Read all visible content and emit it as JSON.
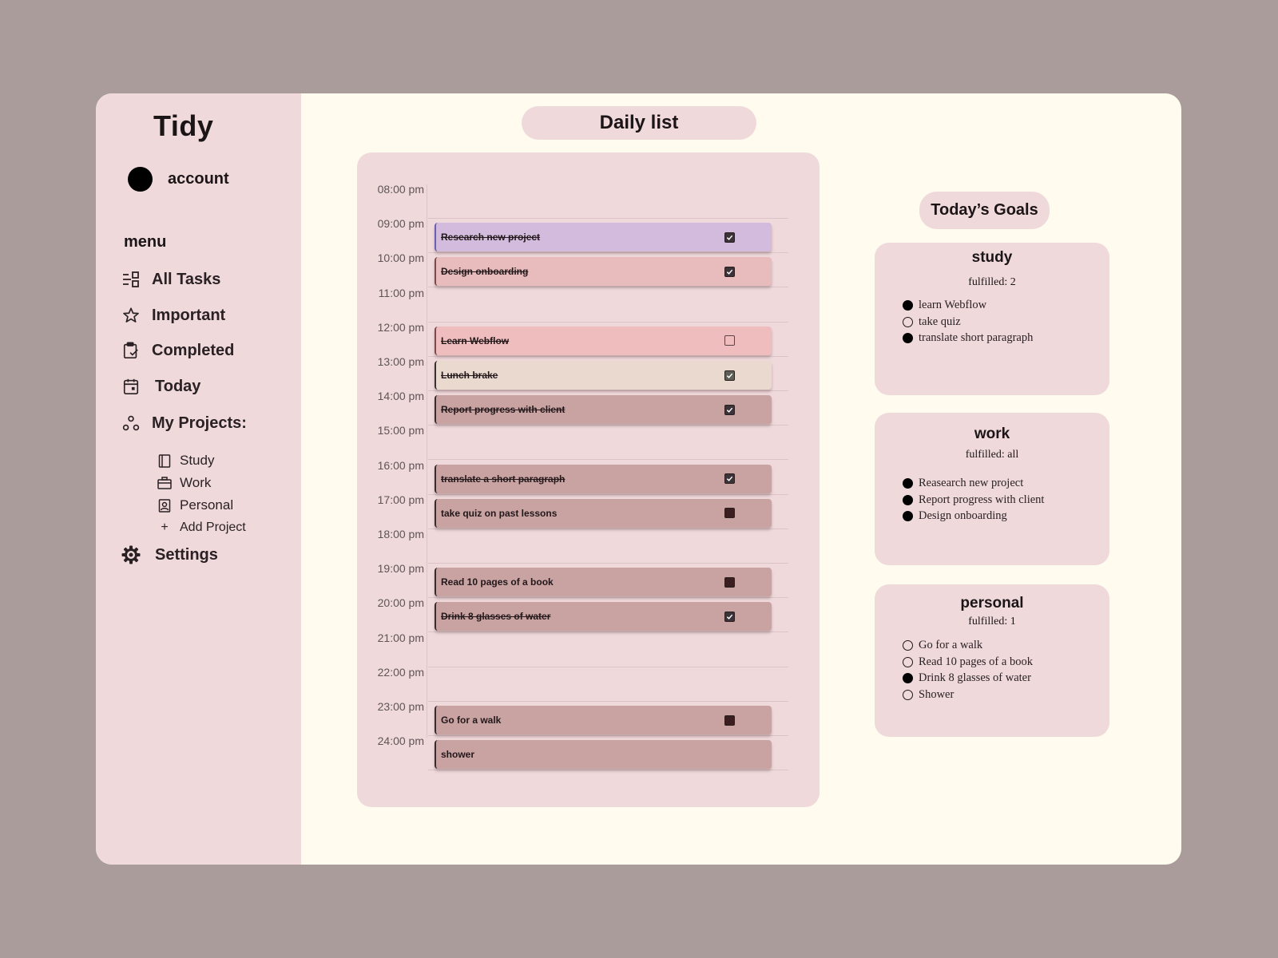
{
  "app": {
    "name": "Tidy"
  },
  "account": {
    "label": "account"
  },
  "sidebar": {
    "menu_label": "menu",
    "items": [
      {
        "label": "All Tasks",
        "icon": "list-icon"
      },
      {
        "label": "Important",
        "icon": "star-icon"
      },
      {
        "label": "Completed",
        "icon": "clipboard-check-icon"
      },
      {
        "label": "Today",
        "icon": "calendar-icon"
      },
      {
        "label": "My Projects:",
        "icon": "projects-icon"
      }
    ],
    "projects": [
      {
        "label": "Study",
        "icon": "book-icon"
      },
      {
        "label": "Work",
        "icon": "briefcase-icon"
      },
      {
        "label": "Personal",
        "icon": "contact-icon"
      }
    ],
    "add_project": "Add Project",
    "settings": "Settings"
  },
  "main": {
    "title": "Daily list"
  },
  "schedule": {
    "rows": [
      {
        "time": "08:00 pm"
      },
      {
        "time": "09:00 pm",
        "task": {
          "label": "Research new project",
          "done": true,
          "checkbox": "checked",
          "color": "#d3bbdd",
          "accent": "#6a5fb0"
        }
      },
      {
        "time": "10:00 pm",
        "task": {
          "label": "Design onboarding",
          "done": true,
          "checkbox": "checked",
          "color": "#e8bcbd",
          "accent": "#7a4a4c"
        }
      },
      {
        "time": "11:00 pm"
      },
      {
        "time": "12:00 pm",
        "task": {
          "label": "Learn Webflow",
          "done": true,
          "checkbox": "empty",
          "color": "#efbdbd",
          "accent": "#7a4a4c"
        }
      },
      {
        "time": "13:00 pm",
        "task": {
          "label": "Lunch brake",
          "done": true,
          "checkbox": "checked-sage",
          "color": "#e9d9ce",
          "accent": "#3a3030"
        }
      },
      {
        "time": "14:00 pm",
        "task": {
          "label": "Report progress with client",
          "done": true,
          "checkbox": "checked",
          "color": "#c9a2a2",
          "accent": "#3a2a2d"
        }
      },
      {
        "time": "15:00 pm"
      },
      {
        "time": "16:00 pm",
        "task": {
          "label": "translate a short paragraph",
          "done": true,
          "checkbox": "checked",
          "color": "#c9a2a2",
          "accent": "#3a2a2d"
        }
      },
      {
        "time": "17:00 pm",
        "task": {
          "label": "take quiz on past lessons",
          "done": false,
          "checkbox": "filled",
          "color": "#c9a2a2",
          "accent": "#3a2a2d"
        }
      },
      {
        "time": "18:00 pm"
      },
      {
        "time": "19:00 pm",
        "task": {
          "label": "Read 10 pages of a book",
          "done": false,
          "checkbox": "filled",
          "color": "#c9a2a2",
          "accent": "#3a2a2d"
        }
      },
      {
        "time": "20:00 pm",
        "task": {
          "label": "Drink 8 glasses of water",
          "done": true,
          "checkbox": "checked",
          "color": "#c9a2a2",
          "accent": "#3a2a2d"
        }
      },
      {
        "time": "21:00 pm"
      },
      {
        "time": "22:00 pm"
      },
      {
        "time": "23:00 pm",
        "task": {
          "label": "Go for a walk",
          "done": false,
          "checkbox": "filled",
          "color": "#c9a2a2",
          "accent": "#3a2a2d"
        }
      },
      {
        "time": "24:00 pm",
        "task": {
          "label": "shower",
          "done": false,
          "checkbox": "none",
          "color": "#c9a2a2",
          "accent": "#3a2a2d"
        }
      }
    ]
  },
  "goals": {
    "title": "Today’s Goals",
    "cards": [
      {
        "name": "study",
        "status": "fulfilled: 2",
        "items": [
          {
            "label": "learn Webflow",
            "done": true
          },
          {
            "label": "take quiz",
            "done": false
          },
          {
            "label": "translate short paragraph",
            "done": true
          }
        ]
      },
      {
        "name": "work",
        "status": "fulfilled: all",
        "items": [
          {
            "label": "Reasearch new project",
            "done": true
          },
          {
            "label": "Report progress with client",
            "done": true
          },
          {
            "label": "Design onboarding",
            "done": true
          }
        ]
      },
      {
        "name": "personal",
        "status": "fulfilled: 1",
        "items": [
          {
            "label": "Go for a walk",
            "done": false
          },
          {
            "label": "Read 10 pages of a book",
            "done": false
          },
          {
            "label": "Drink 8 glasses of water",
            "done": true
          },
          {
            "label": "Shower",
            "done": false
          }
        ]
      }
    ]
  },
  "colors": {
    "page_bg": "#a99c9b",
    "app_bg": "#fffbef",
    "panel": "#efd9db"
  }
}
